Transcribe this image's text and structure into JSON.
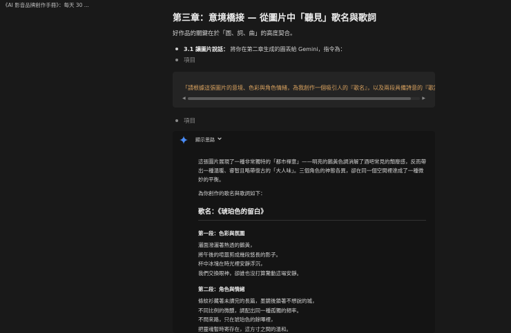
{
  "window": {
    "title": "《AI 影音品牌創作手冊》：每天 30 ..."
  },
  "chapter": {
    "title": "第三章：意境橋接 — 從圖片中「聽見」歌名與歌詞",
    "intro": "好作品的關鍵在於「圖、詞、曲」的高度契合。"
  },
  "bullets": [
    {
      "label": "3.1 讓圖片說話：",
      "text": "將你在第二章生成的圖丟給 Gemini，指令為："
    }
  ],
  "item_label": "項目",
  "prompt": {
    "text": "「請根據這張圖片的意境、色彩與角色情緒，為我創作一個吸引人的『歌名』，以及兩段具備詩意的『歌詞",
    "scroll_left": "◀",
    "scroll_right": "▶",
    "scroll_progress": 0.96
  },
  "answer": {
    "icon": "gemini-sparkle-icon",
    "show_thinking": "顯示思路",
    "chevron": "chevron-down-icon",
    "para1": "這張圖片展現了一種非常獨特的「都市禪意」——明亮的鵝黃色調消解了酒吧常見的頹廢感，反而帶出一種溫暖、睿智且略帶復古的「大人味」。三個角色的神態各異，卻在同一個空間裡達成了一種微妙的平衡。",
    "para2": "為你創作的歌名與歌詞如下：",
    "song_title": "歌名：《琥珀色的留白》",
    "sections": [
      {
        "heading": "第一段：色彩與氛圍",
        "lines": [
          "灑面潑灑著熟透的鵝黃，",
          "將午後的喧囂剪成幾段悠長的影子。",
          "杯中冰塊在時光裡安靜浮沉，",
          "我們交換眼神，卻誰也沒打算驚動這場安靜。"
        ]
      },
      {
        "heading": "第二段：角色與情緒",
        "lines": [
          "條紋衫藏著未讀完的長篇，墨鏡後鎖著不想說的城，",
          "不同比例的微醺，調配出同一種孤獨的頻率。",
          "不問來路，只在琥珀色的餘暉裡，",
          "把靈魂暫時寄存在，這方寸之間的溫和。"
        ]
      }
    ]
  },
  "colors": {
    "background": "#191919",
    "code_text": "#d9a25f",
    "gemini_blue": "#4a8cf7"
  }
}
